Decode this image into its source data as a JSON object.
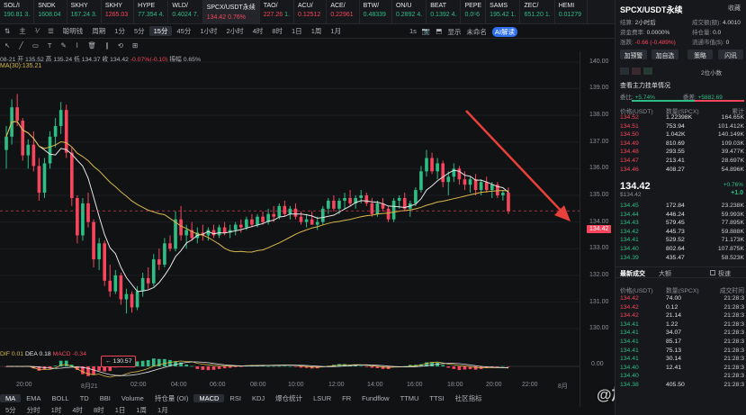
{
  "ticker": [
    {
      "name": "SOL/I",
      "price": "190.81",
      "chg": "3."
    },
    {
      "name": "SNDK",
      "price": "1608.04",
      "chg": ""
    },
    {
      "name": "SKHY",
      "price": "167.24",
      "chg": "3."
    },
    {
      "name": "SKHY",
      "price": "1265.03",
      "chg": ""
    },
    {
      "name": "HYPE",
      "price": "77.354",
      "chg": "4."
    },
    {
      "name": "WLD/",
      "price": "0.4024",
      "chg": "7."
    },
    {
      "name": "SPCX/USDT永续",
      "price": "134.42",
      "chg": "0.76%"
    },
    {
      "name": "TAO/",
      "price": "227.26",
      "chg": "1."
    },
    {
      "name": "ACU/",
      "price": "0.12512",
      "chg": ""
    },
    {
      "name": "ACE/",
      "price": "0.22961",
      "chg": ""
    },
    {
      "name": "BTW/",
      "price": "0.48339",
      "chg": ""
    },
    {
      "name": "ON/U",
      "price": "0.2892",
      "chg": "4."
    },
    {
      "name": "BEAT",
      "price": "0.1392",
      "chg": "4."
    },
    {
      "name": "PEPE",
      "price": "0.0⁵6",
      "chg": ""
    },
    {
      "name": "SAMS",
      "price": "195.42",
      "chg": "1."
    },
    {
      "name": "ZEC/",
      "price": "651.20",
      "chg": "1."
    },
    {
      "name": "HEMI",
      "price": "0.01279",
      "chg": ""
    }
  ],
  "toolbar": {
    "items": [
      "⇅",
      "主",
      "⅟",
      "☰",
      "聪明钱",
      "周期",
      "1分",
      "5分",
      "15分",
      "45分",
      "1小时",
      "2小时",
      "4时",
      "8时",
      "1日",
      "1周",
      "1月"
    ],
    "right": [
      "1s",
      "📷",
      "⬒",
      "显示",
      "未命名",
      "AI解读"
    ],
    "active": "15分"
  },
  "toolbar2": [
    "↖",
    "╱",
    "▭",
    "T",
    "✎",
    "⌇",
    "🗑",
    "∥",
    "⟲",
    "⊞"
  ],
  "info_line": {
    "date": "08-21",
    "open": "开 135.52",
    "high": "高 135.24",
    "low": "低 134.37",
    "close": "收 134.42",
    "chg": "-0.07%(-0.10)",
    "amp": "振幅 0.65%"
  },
  "ma_label": "MA(30):135.21",
  "y_axis": [
    "140.00",
    "139.00",
    "138.00",
    "137.00",
    "136.00",
    "135.00",
    "134.00",
    "133.00",
    "132.00",
    "131.00",
    "130.00"
  ],
  "current_price": "134.42",
  "low_marker": "← 130.57",
  "macd_label": {
    "dif": "DIF 0.01",
    "dea": "DEA 0.18",
    "macd": "MACD -0.34"
  },
  "macd_zero": "0.00",
  "x_axis": [
    "20:00",
    "8月21",
    "02:00",
    "04:00",
    "06:00",
    "08:00",
    "10:00",
    "12:00",
    "14:00",
    "16:00",
    "18:00",
    "20:00",
    "22:00",
    "8月"
  ],
  "indicators": [
    "MA",
    "EMA",
    "BOLL",
    "TD",
    "BBI",
    "Volume",
    "持仓量 (OI)",
    "MACD",
    "RSI",
    "KDJ",
    "爆仓统计",
    "LSUR",
    "FR",
    "Fundflow",
    "TTMU",
    "TTSI",
    "社区指标"
  ],
  "indicators_active": [
    "MA",
    "MACD"
  ],
  "periods": [
    "5分",
    "分时",
    "1时",
    "4时",
    "8时",
    "1日",
    "1周",
    "1月"
  ],
  "panel": {
    "title": "SPCX/USDT永续",
    "fav": "收藏",
    "funding_label": "结算:",
    "funding_time": "2小时后",
    "funding_rate_label": "资金费率:",
    "funding_rate": "0.0000%",
    "change_label": "涨跌:",
    "change": "-0.66 (-0.489%)",
    "vol_label": "成交额(额):",
    "vol": "4.0010",
    "oi_label": "持仓量:",
    "oi": "0.0",
    "mcap_label": "流通市值($):",
    "mcap": "0",
    "buttons": [
      "加预警",
      "加自选",
      "策略",
      "闪讯"
    ],
    "depth_select": "2位小数",
    "orderbook_title": "查看主力挂单情况",
    "bid_ratio_label": "委比:",
    "bid_ratio": "+5.74%",
    "bid_diff_label": "委差:",
    "bid_diff": "+5882.69",
    "ob_headers": [
      "价格(USDT)",
      "数量(SPCX)",
      "累计"
    ],
    "asks": [
      [
        "134.52",
        "1.22398K",
        "164.65K"
      ],
      [
        "134.51",
        "753.94",
        "101.412K"
      ],
      [
        "134.50",
        "1.042K",
        "140.149K"
      ],
      [
        "134.49",
        "810.69",
        "109.03K"
      ],
      [
        "134.48",
        "293.55",
        "39.477K"
      ],
      [
        "134.47",
        "213.41",
        "28.697K"
      ],
      [
        "134.46",
        "408.27",
        "54.896K"
      ]
    ],
    "mid_price": "134.42",
    "mid_usd": "$134.42",
    "mid_change": "+0.76%",
    "mid_change2": "+1.0",
    "bids": [
      [
        "134.45",
        "172.84",
        "23.238K"
      ],
      [
        "134.44",
        "446.24",
        "59.993K"
      ],
      [
        "134.43",
        "579.45",
        "77.895K"
      ],
      [
        "134.42",
        "445.73",
        "59.888K"
      ],
      [
        "134.41",
        "529.52",
        "71.173K"
      ],
      [
        "134.40",
        "802.64",
        "107.875K"
      ],
      [
        "134.39",
        "435.47",
        "58.523K"
      ]
    ],
    "trades_tabs": [
      "最新成交",
      "大额"
    ],
    "trades_toggle": "极速",
    "tr_headers": [
      "价格(USDT)",
      "数量(SPCX)",
      "成交时间"
    ],
    "trades": [
      [
        "134.42",
        "74.00",
        "21:28:3"
      ],
      [
        "134.42",
        "0.12",
        "21:28:3"
      ],
      [
        "134.42",
        "21.14",
        "21:28:3"
      ],
      [
        "134.41",
        "1.22",
        "21:28:3"
      ],
      [
        "134.41",
        "34.07",
        "21:28:3"
      ],
      [
        "134.41",
        "85.17",
        "21:28:3"
      ],
      [
        "134.41",
        "75.13",
        "21:28:3"
      ],
      [
        "134.41",
        "30.14",
        "21:28:3"
      ],
      [
        "134.40",
        "12.41",
        "21:28:3"
      ],
      [
        "134.40",
        "",
        "21:28:3"
      ],
      [
        "134.38",
        "405.50",
        "21:28:3"
      ]
    ]
  },
  "watermark": "@加密猎手数据",
  "colors": {
    "up": "#2ebd85",
    "down": "#f6465d",
    "ma_white": "#e6e6e6",
    "ma_yellow": "#d6b94a",
    "arrow": "#e8403a"
  },
  "chart_data": {
    "type": "candlestick",
    "ylim": [
      129.6,
      140.4
    ],
    "candles": [
      [
        136.7,
        137.6,
        136.0,
        137.2
      ],
      [
        137.2,
        138.6,
        136.9,
        138.3
      ],
      [
        138.3,
        138.8,
        137.6,
        137.8
      ],
      [
        137.8,
        137.9,
        136.3,
        136.5
      ],
      [
        136.5,
        137.1,
        136.0,
        136.9
      ],
      [
        136.9,
        137.4,
        135.9,
        136.1
      ],
      [
        136.1,
        136.4,
        134.8,
        135.1
      ],
      [
        135.1,
        136.4,
        134.9,
        136.2
      ],
      [
        136.2,
        137.4,
        136.0,
        137.2
      ],
      [
        137.2,
        137.9,
        136.8,
        137.6
      ],
      [
        137.6,
        138.5,
        137.3,
        138.2
      ],
      [
        138.2,
        138.4,
        136.4,
        136.6
      ],
      [
        136.6,
        136.8,
        134.6,
        134.9
      ],
      [
        134.9,
        135.0,
        133.2,
        133.5
      ],
      [
        133.5,
        134.9,
        133.3,
        134.7
      ],
      [
        134.7,
        135.1,
        133.8,
        134.0
      ],
      [
        134.0,
        134.1,
        132.3,
        132.6
      ],
      [
        132.6,
        133.4,
        132.2,
        133.2
      ],
      [
        133.2,
        133.3,
        131.6,
        131.8
      ],
      [
        131.8,
        132.4,
        131.2,
        131.4
      ],
      [
        131.4,
        132.2,
        131.3,
        132.0
      ],
      [
        132.0,
        132.1,
        130.9,
        131.1
      ],
      [
        131.1,
        131.5,
        130.57,
        131.3
      ],
      [
        131.3,
        131.4,
        130.6,
        130.8
      ],
      [
        130.8,
        131.6,
        130.7,
        131.4
      ],
      [
        131.4,
        132.1,
        131.2,
        131.9
      ],
      [
        131.9,
        132.3,
        131.5,
        131.7
      ],
      [
        131.7,
        132.8,
        131.6,
        132.6
      ],
      [
        132.6,
        133.0,
        132.2,
        132.4
      ],
      [
        132.4,
        133.4,
        132.3,
        133.2
      ],
      [
        133.2,
        133.5,
        132.9,
        133.0
      ],
      [
        133.0,
        134.4,
        132.9,
        134.1
      ],
      [
        134.1,
        134.6,
        133.3,
        133.5
      ],
      [
        133.5,
        133.9,
        133.0,
        133.7
      ],
      [
        133.7,
        134.0,
        133.3,
        133.4
      ],
      [
        133.4,
        133.8,
        133.2,
        133.6
      ],
      [
        133.6,
        133.9,
        133.3,
        133.5
      ],
      [
        133.5,
        133.8,
        133.3,
        133.7
      ],
      [
        133.7,
        133.9,
        133.4,
        133.5
      ],
      [
        133.5,
        133.9,
        133.4,
        133.8
      ],
      [
        133.8,
        134.0,
        133.5,
        133.6
      ],
      [
        133.6,
        133.9,
        133.4,
        133.7
      ],
      [
        133.7,
        134.0,
        133.5,
        133.9
      ],
      [
        133.9,
        134.1,
        133.6,
        133.8
      ],
      [
        133.8,
        134.2,
        133.7,
        134.1
      ],
      [
        134.1,
        134.3,
        133.8,
        133.9
      ],
      [
        133.9,
        134.3,
        133.8,
        134.2
      ],
      [
        134.2,
        134.4,
        133.9,
        134.0
      ],
      [
        134.0,
        134.5,
        133.9,
        134.3
      ],
      [
        134.3,
        134.6,
        134.0,
        134.2
      ],
      [
        134.2,
        134.7,
        134.1,
        134.6
      ],
      [
        134.6,
        134.8,
        134.2,
        134.3
      ],
      [
        134.3,
        134.6,
        134.1,
        134.5
      ],
      [
        134.5,
        134.7,
        134.1,
        134.2
      ],
      [
        134.2,
        134.4,
        133.9,
        134.0
      ],
      [
        134.0,
        134.3,
        133.8,
        134.1
      ],
      [
        134.1,
        134.4,
        133.9,
        133.9
      ],
      [
        133.9,
        134.2,
        133.7,
        134.0
      ],
      [
        134.0,
        134.6,
        133.9,
        134.5
      ],
      [
        134.5,
        134.9,
        134.3,
        134.8
      ],
      [
        134.8,
        135.0,
        134.4,
        134.5
      ],
      [
        134.5,
        134.9,
        134.3,
        134.8
      ],
      [
        134.8,
        135.1,
        134.5,
        134.9
      ],
      [
        134.9,
        135.2,
        134.6,
        134.7
      ],
      [
        134.7,
        135.0,
        134.5,
        134.9
      ],
      [
        134.9,
        135.2,
        134.7,
        135.0
      ],
      [
        135.0,
        135.1,
        134.6,
        134.7
      ],
      [
        134.7,
        134.9,
        134.2,
        134.3
      ],
      [
        134.3,
        134.8,
        134.2,
        134.7
      ],
      [
        134.7,
        134.9,
        134.4,
        134.5
      ],
      [
        134.5,
        134.6,
        134.0,
        134.1
      ],
      [
        134.1,
        134.9,
        134.0,
        134.8
      ],
      [
        134.8,
        135.0,
        134.5,
        134.9
      ],
      [
        134.9,
        135.1,
        134.4,
        134.5
      ],
      [
        134.5,
        134.8,
        134.2,
        134.7
      ],
      [
        134.7,
        135.3,
        134.6,
        135.2
      ],
      [
        135.2,
        136.1,
        135.1,
        135.9
      ],
      [
        135.9,
        136.7,
        135.7,
        136.4
      ],
      [
        136.4,
        136.6,
        135.8,
        135.9
      ],
      [
        135.9,
        136.4,
        135.6,
        136.2
      ],
      [
        136.2,
        136.3,
        135.3,
        135.5
      ],
      [
        135.5,
        135.9,
        135.0,
        135.7
      ],
      [
        135.7,
        136.2,
        135.5,
        136.0
      ],
      [
        136.0,
        136.1,
        135.4,
        135.6
      ],
      [
        135.6,
        135.9,
        135.2,
        135.4
      ],
      [
        135.4,
        135.7,
        135.1,
        135.6
      ],
      [
        135.6,
        135.8,
        135.0,
        135.2
      ],
      [
        135.2,
        135.6,
        135.0,
        135.5
      ],
      [
        135.5,
        135.7,
        135.1,
        135.2
      ],
      [
        135.2,
        135.5,
        134.9,
        135.4
      ],
      [
        135.4,
        135.5,
        134.9,
        135.0
      ],
      [
        135.0,
        135.2,
        134.8,
        135.1
      ],
      [
        135.1,
        135.3,
        134.3,
        134.4
      ]
    ]
  }
}
